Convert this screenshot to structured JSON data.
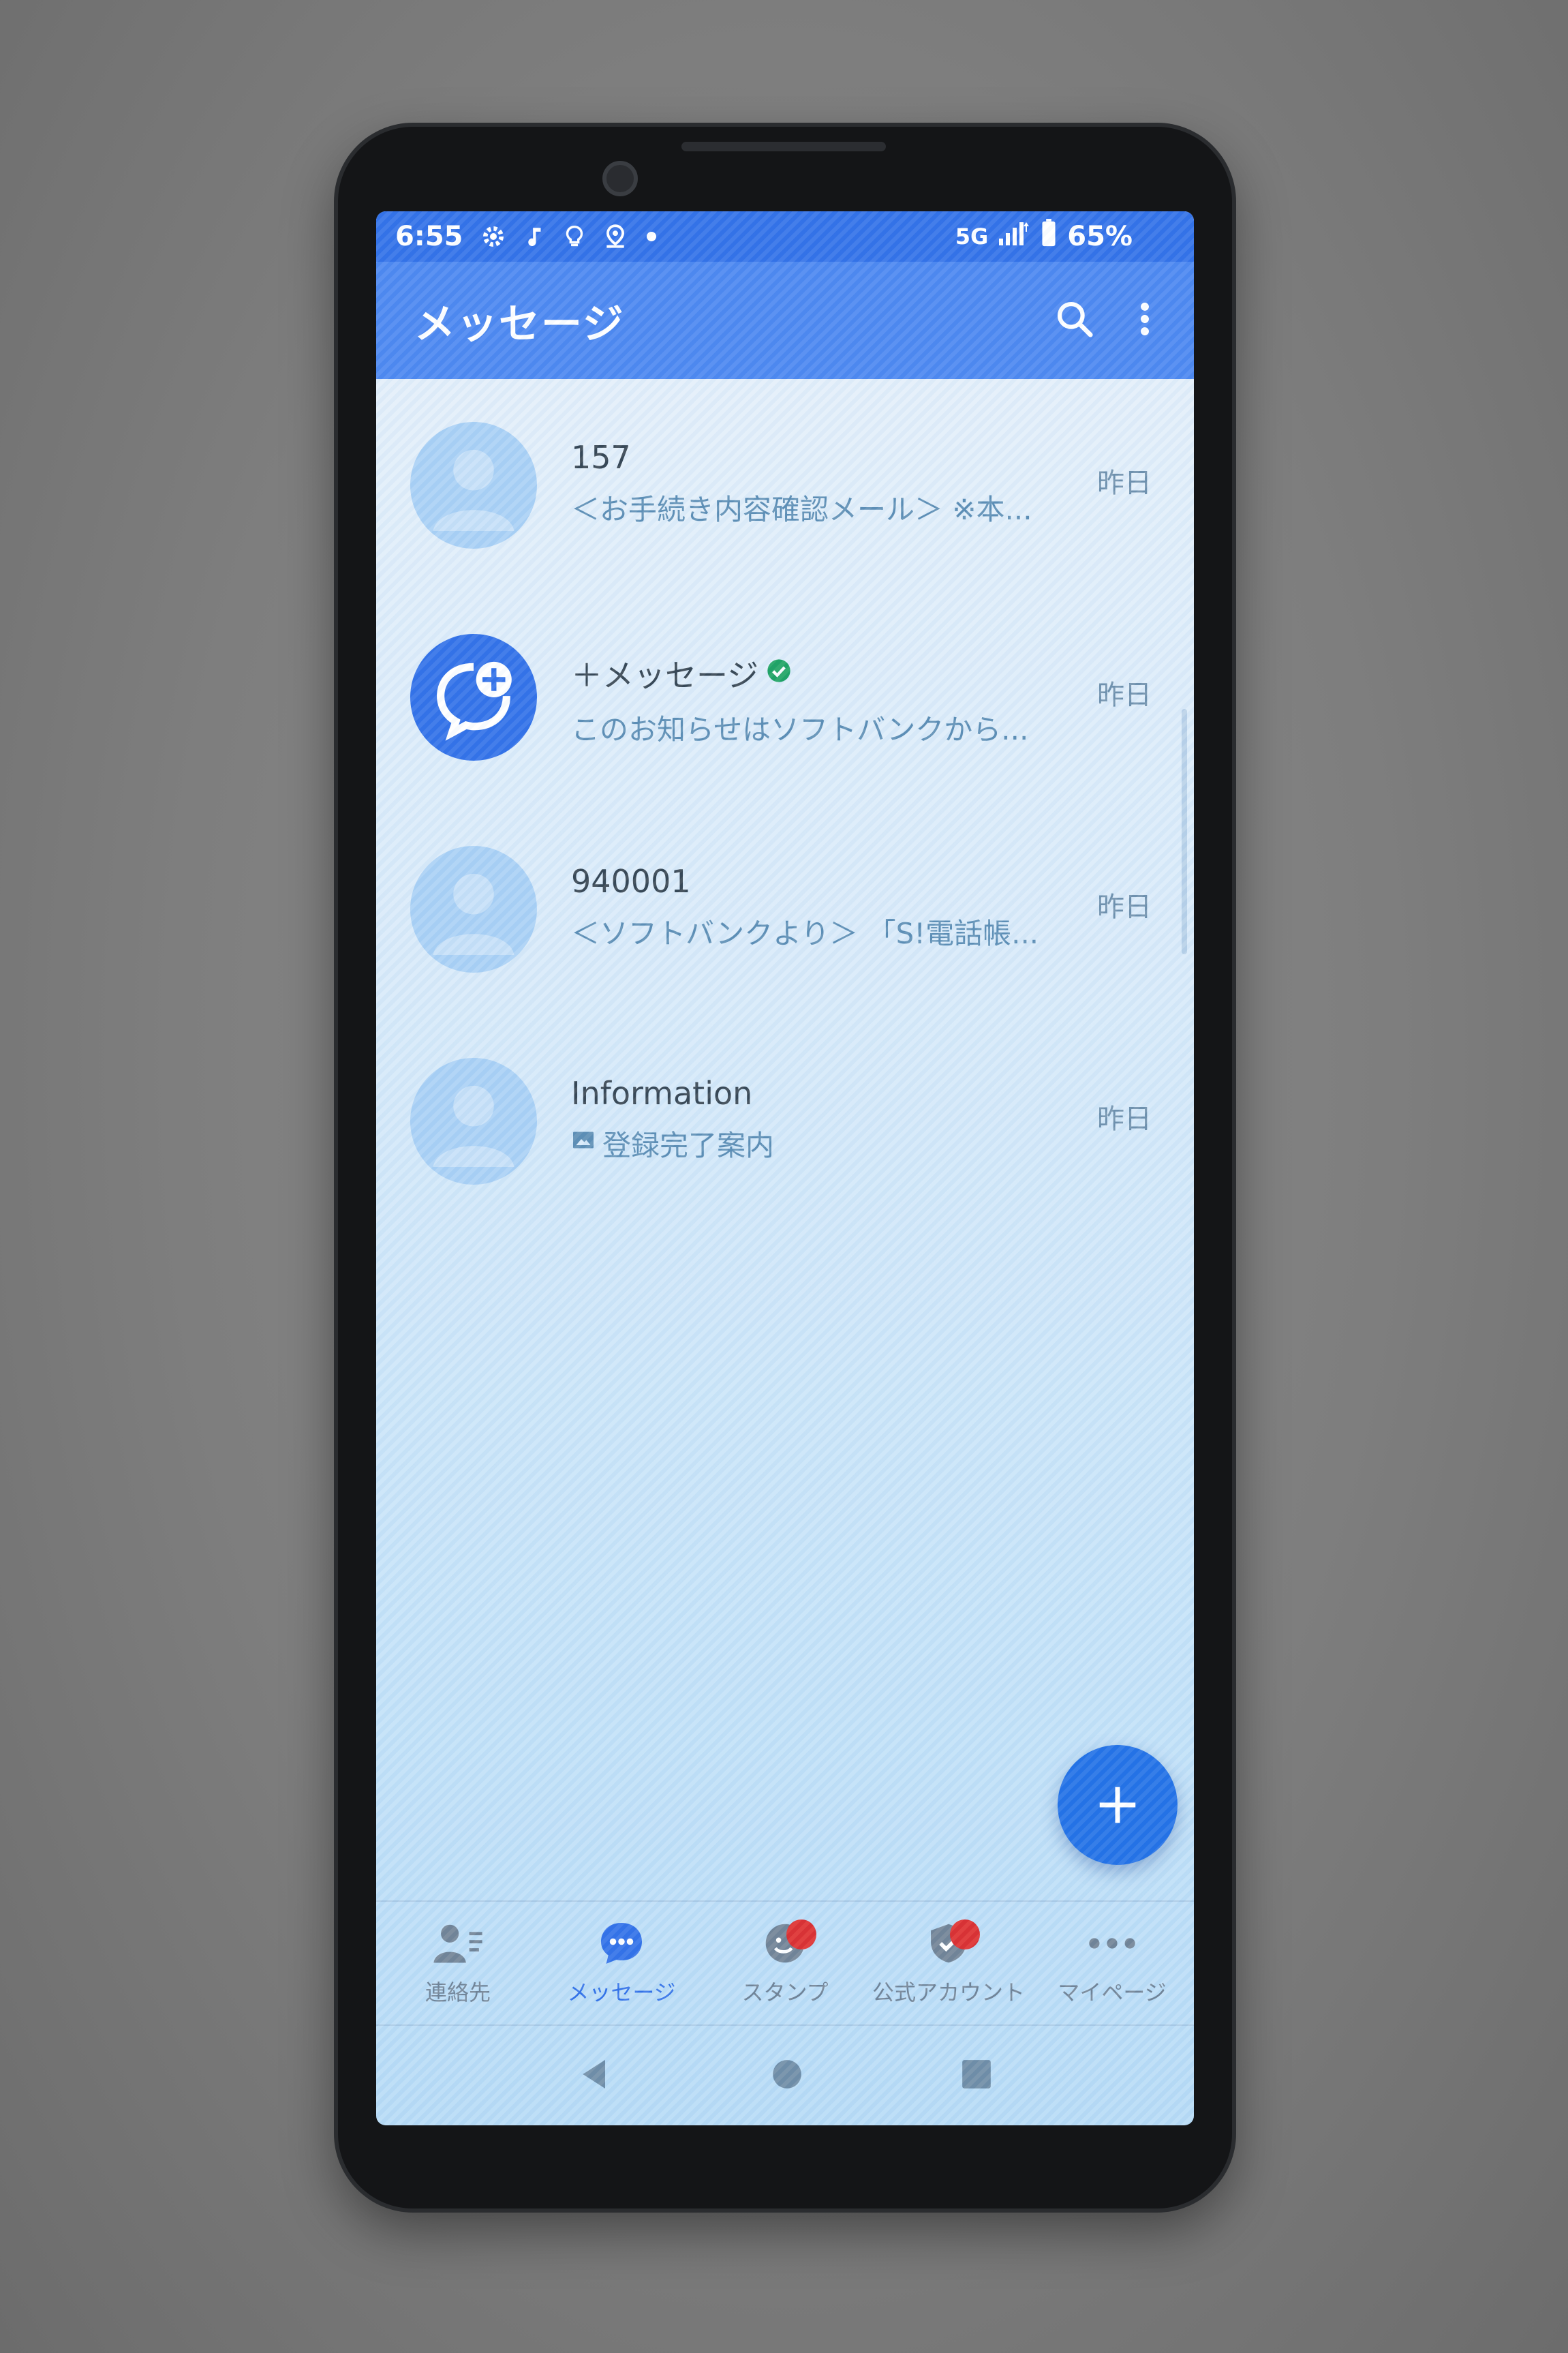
{
  "status_bar": {
    "time": "6:55",
    "network": "5G",
    "battery": "65%"
  },
  "app_bar": {
    "title": "メッセージ"
  },
  "conversations": [
    {
      "name": "157",
      "preview": "＜お手続き内容確認メール＞ ※本...",
      "date": "昨日",
      "avatar": "person-icon",
      "verified": false
    },
    {
      "name": "＋メッセージ",
      "preview": "このお知らせはソフトバンクから...",
      "date": "昨日",
      "avatar": "plus-message-logo",
      "verified": true
    },
    {
      "name": "940001",
      "preview": "＜ソフトバンクより＞ 「S!電話帳...",
      "date": "昨日",
      "avatar": "person-icon",
      "verified": false
    },
    {
      "name": "Information",
      "preview": "登録完了案内",
      "date": "昨日",
      "avatar": "person-icon",
      "verified": false,
      "preview_icon": "image-icon"
    }
  ],
  "bottom_nav": [
    {
      "label": "連絡先",
      "icon": "contacts-icon"
    },
    {
      "label": "メッセージ",
      "icon": "message-icon",
      "active": true
    },
    {
      "label": "スタンプ",
      "icon": "stamp-icon",
      "badge": true
    },
    {
      "label": "公式アカウント",
      "icon": "official-account-icon",
      "badge": true
    },
    {
      "label": "マイページ",
      "icon": "more-icon"
    }
  ],
  "colors": {
    "accent": "#2f6fe8",
    "app_bar": "#4a86f0",
    "badge": "#dd2b2b",
    "verified": "#1aa260"
  }
}
